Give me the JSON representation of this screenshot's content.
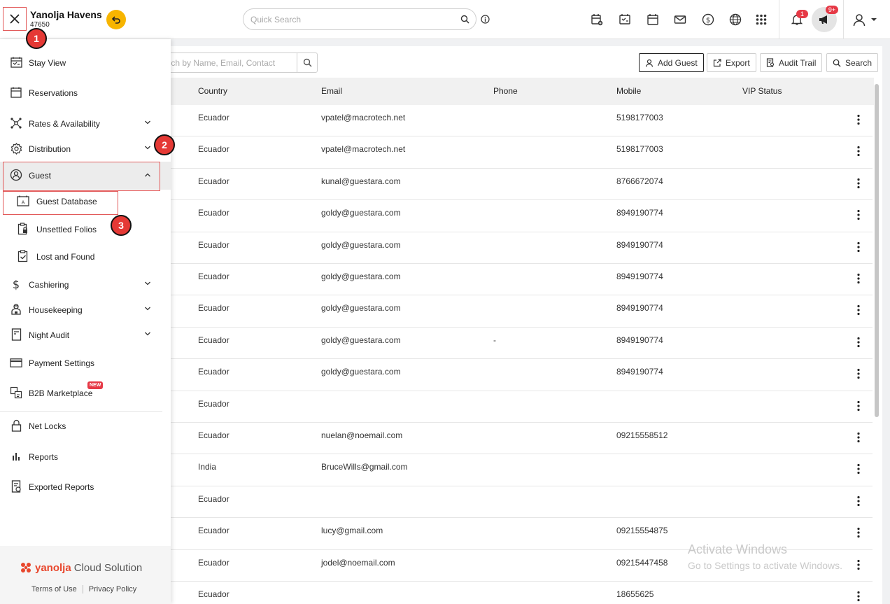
{
  "header": {
    "hotel_name": "Yanolja Havens",
    "hotel_code": "47650",
    "search_placeholder": "Quick Search",
    "notification_count": "1",
    "announcement_count": "9+"
  },
  "toolbar": {
    "guest_search_placeholder": "Search by Name, Email, Contact",
    "add_guest": "Add Guest",
    "export": "Export",
    "audit_trail": "Audit Trail",
    "search": "Search"
  },
  "table": {
    "columns": [
      "Country",
      "Email",
      "Phone",
      "Mobile",
      "VIP Status"
    ],
    "rows": [
      {
        "country": "Ecuador",
        "email": "vpatel@macrotech.net",
        "phone": "",
        "mobile": "5198177003"
      },
      {
        "country": "Ecuador",
        "email": "vpatel@macrotech.net",
        "phone": "",
        "mobile": "5198177003"
      },
      {
        "country": "Ecuador",
        "email": "kunal@guestara.com",
        "phone": "",
        "mobile": "8766672074"
      },
      {
        "country": "Ecuador",
        "email": "goldy@guestara.com",
        "phone": "",
        "mobile": "8949190774"
      },
      {
        "country": "Ecuador",
        "email": "goldy@guestara.com",
        "phone": "",
        "mobile": "8949190774"
      },
      {
        "country": "Ecuador",
        "email": "goldy@guestara.com",
        "phone": "",
        "mobile": "8949190774"
      },
      {
        "country": "Ecuador",
        "email": "goldy@guestara.com",
        "phone": "",
        "mobile": "8949190774"
      },
      {
        "country": "Ecuador",
        "email": "goldy@guestara.com",
        "phone": "-",
        "mobile": "8949190774"
      },
      {
        "country": "Ecuador",
        "email": "goldy@guestara.com",
        "phone": "",
        "mobile": "8949190774"
      },
      {
        "country": "Ecuador",
        "email": "",
        "phone": "",
        "mobile": ""
      },
      {
        "country": "Ecuador",
        "email": "nuelan@noemail.com",
        "phone": "",
        "mobile": "09215558512"
      },
      {
        "country": "India",
        "email": "BruceWills@gmail.com",
        "phone": "",
        "mobile": ""
      },
      {
        "country": "Ecuador",
        "email": "",
        "phone": "",
        "mobile": ""
      },
      {
        "country": "Ecuador",
        "email": "lucy@gmail.com",
        "phone": "",
        "mobile": "09215554875"
      },
      {
        "country": "Ecuador",
        "email": "jodel@noemail.com",
        "phone": "",
        "mobile": "09215447458"
      },
      {
        "country": "Ecuador",
        "email": "",
        "phone": "",
        "mobile": "18655625"
      }
    ]
  },
  "sidebar": {
    "items": [
      {
        "label": "Stay View",
        "icon": "calendar-check-icon"
      },
      {
        "label": "Reservations",
        "icon": "calendar-icon"
      },
      {
        "label": "Rates & Availability",
        "icon": "network-icon"
      },
      {
        "label": "Distribution",
        "icon": "gear-icon"
      },
      {
        "label": "Guest",
        "icon": "guest-icon"
      },
      {
        "label": "Guest Database",
        "icon": "id-card-icon"
      },
      {
        "label": "Unsettled Folios",
        "icon": "clipboard-lock-icon"
      },
      {
        "label": "Lost and Found",
        "icon": "clipboard-check-icon"
      },
      {
        "label": "Cashiering",
        "icon": "dollar-icon"
      },
      {
        "label": "Housekeeping",
        "icon": "housekeeping-icon"
      },
      {
        "label": "Night Audit",
        "icon": "document-icon"
      },
      {
        "label": "Payment Settings",
        "icon": "card-icon"
      },
      {
        "label": "B2B Marketplace",
        "icon": "marketplace-icon"
      },
      {
        "label": "Net Locks",
        "icon": "lock-icon"
      },
      {
        "label": "Reports",
        "icon": "bar-chart-icon"
      },
      {
        "label": "Exported Reports",
        "icon": "export-doc-icon"
      }
    ],
    "new_badge": "NEW",
    "brand_logo": "yanolja",
    "brand_suffix": "Cloud Solution",
    "terms": "Terms of Use",
    "privacy": "Privacy Policy"
  },
  "callouts": [
    "1",
    "2",
    "3"
  ],
  "watermark": {
    "line1": "Activate Windows",
    "line2": "Go to Settings to activate Windows."
  },
  "colors": {
    "accent": "#f7b500",
    "badge": "#e63946",
    "highlight": "#e25a5a"
  }
}
